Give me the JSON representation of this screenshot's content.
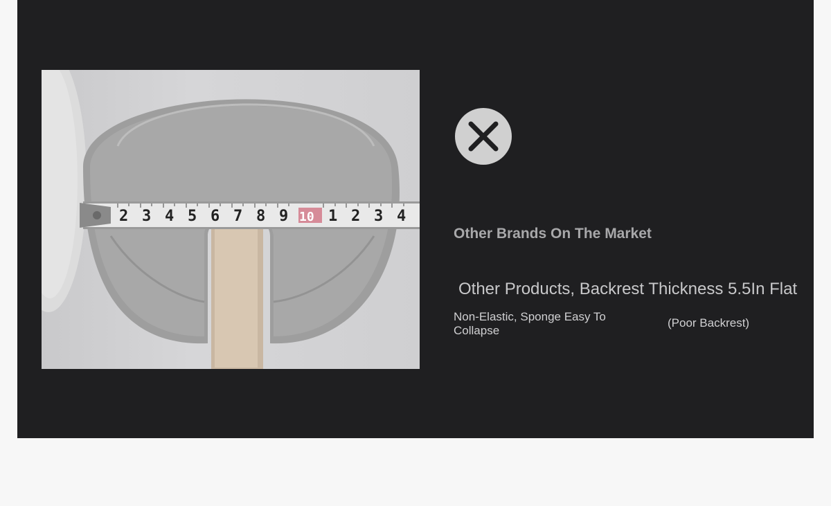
{
  "comparison": {
    "product_photo": {
      "icon": "tape-measure-pillow-photo",
      "tape_digits": [
        "2",
        "3",
        "4",
        "5",
        "6",
        "7",
        "8",
        "9",
        "10",
        "1",
        "2",
        "3",
        "4"
      ]
    },
    "badge_icon": "close-x-icon",
    "heading": "Other Brands On The Market",
    "subheading": "Other Products, Backrest Thickness 5.5In Flat",
    "feature_text": "Non-Elastic, Sponge Easy To Collapse",
    "note_text": "(Poor Backrest)",
    "colors": {
      "panel_bg": "#1f1f21",
      "page_bg": "#f7f7f7",
      "badge_bg": "#d0d0d0",
      "badge_x": "#1f1f21"
    }
  }
}
